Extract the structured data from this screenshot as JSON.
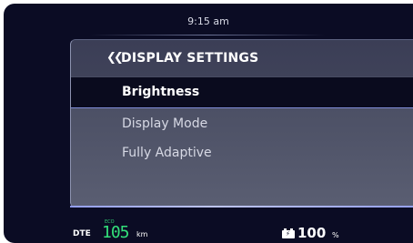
{
  "status": {
    "time": "9:15 am"
  },
  "menu": {
    "back_icon": "double-chevron-left-icon",
    "title": "DISPLAY SETTINGS",
    "items": [
      {
        "label": "Brightness",
        "selected": true
      },
      {
        "label": "Display Mode",
        "selected": false
      },
      {
        "label": "Fully Adaptive",
        "selected": false
      }
    ]
  },
  "footer": {
    "dte_label": "DTE",
    "mode_label": "ECO",
    "range_value": "105",
    "range_unit": "km",
    "battery_icon": "battery-charging-icon",
    "battery_value": "100",
    "battery_unit": "%"
  },
  "colors": {
    "screen_bg": "#0b0c24",
    "panel_bg": "#4d5166",
    "selected_row_bg": "#0a0b1e",
    "selection_accent": "#7e8bd6",
    "range_green": "#33e07a"
  }
}
